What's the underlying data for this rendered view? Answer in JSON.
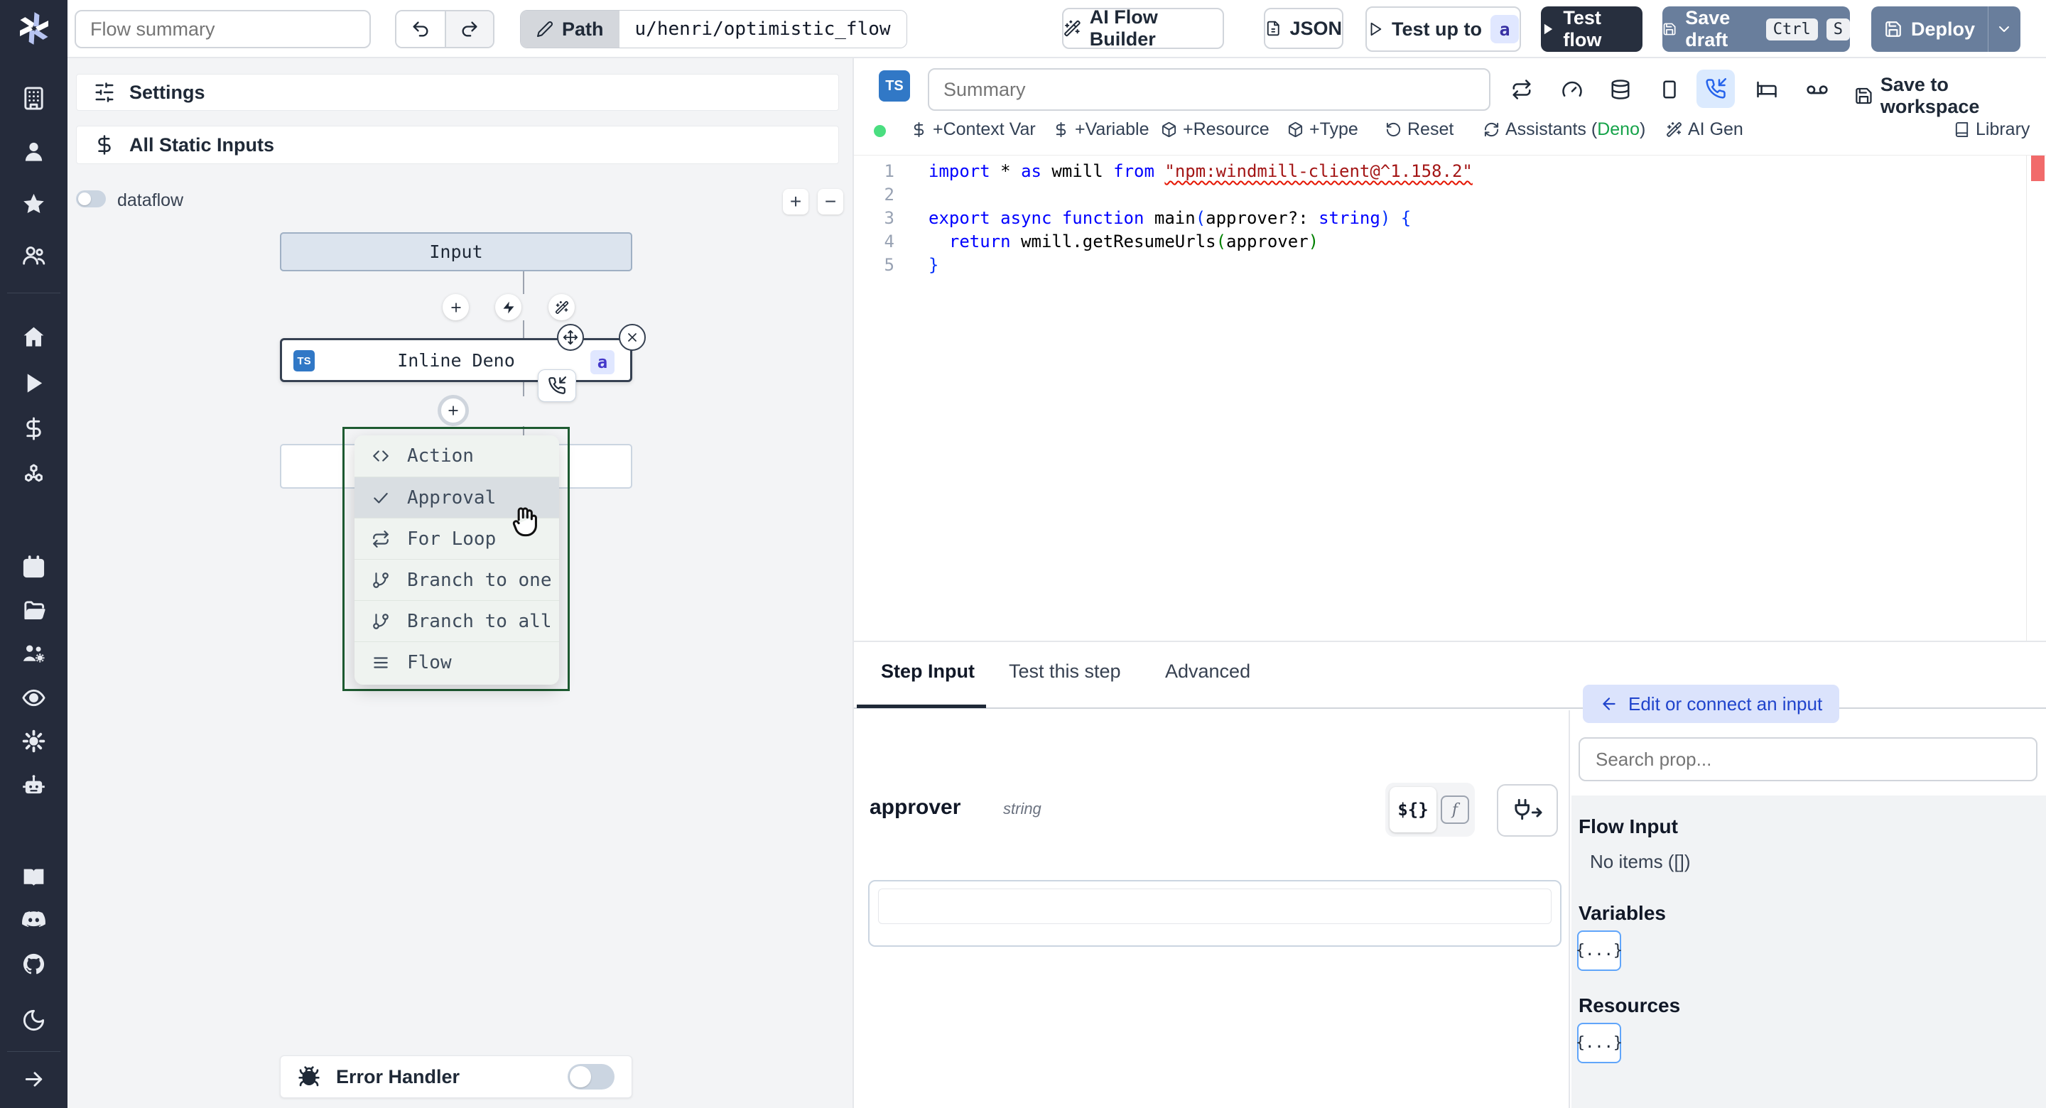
{
  "topbar": {
    "flow_summary_placeholder": "Flow summary",
    "path_label": "Path",
    "path_value": "u/henri/optimistic_flow",
    "ai_flow_builder": "AI Flow Builder",
    "json_button": "JSON",
    "test_up_to": "Test up to",
    "test_up_to_badge": "a",
    "test_flow": "Test flow",
    "save_draft": "Save draft",
    "kbd_ctrl": "Ctrl",
    "kbd_s": "S",
    "deploy": "Deploy"
  },
  "sidebar": {
    "icons": [
      "building",
      "user",
      "star",
      "users",
      "home",
      "play",
      "dollar",
      "boxes",
      "calendar",
      "folder-open",
      "users-gear",
      "eye",
      "settings",
      "bot",
      "book-open",
      "discord",
      "github",
      "moon",
      "arrow-right"
    ]
  },
  "flow": {
    "settings_label": "Settings",
    "static_inputs_label": "All Static Inputs",
    "dataflow_label": "dataflow",
    "zoom_in": "+",
    "zoom_out": "−",
    "input_node": "Input",
    "step_node": "Inline Deno",
    "step_lang_badge": "TS",
    "step_suffix_badge": "a",
    "menu": [
      {
        "icon": "code",
        "label": "Action"
      },
      {
        "icon": "check",
        "label": "Approval"
      },
      {
        "icon": "repeat",
        "label": "For Loop"
      },
      {
        "icon": "git-branch",
        "label": "Branch to one"
      },
      {
        "icon": "git-branch",
        "label": "Branch to all"
      },
      {
        "icon": "menu",
        "label": "Flow"
      }
    ],
    "menu_active_index": 1,
    "error_handler_label": "Error Handler"
  },
  "editor": {
    "lang_badge": "TS",
    "summary_placeholder": "Summary",
    "actions": [
      "+Context Var",
      "+Variable",
      "+Resource",
      "+Type",
      "Reset"
    ],
    "assistants_prefix": "Assistants (",
    "assistants_lang": "Deno",
    "assistants_suffix": ")",
    "ai_gen": "AI Gen",
    "library": "Library",
    "save_to_workspace": "Save to workspace",
    "code": [
      [
        {
          "t": "import",
          "c": "kw"
        },
        {
          "t": " * ",
          "c": "pl"
        },
        {
          "t": "as",
          "c": "kw"
        },
        {
          "t": " wmill ",
          "c": "pl"
        },
        {
          "t": "from",
          "c": "kw"
        },
        {
          "t": " ",
          "c": "pl"
        },
        {
          "t": "\"npm:windmill-client@^1.158.2\"",
          "c": "str sq"
        }
      ],
      [],
      [
        {
          "t": "export",
          "c": "kw"
        },
        {
          "t": " ",
          "c": "pl"
        },
        {
          "t": "async",
          "c": "kw"
        },
        {
          "t": " ",
          "c": "pl"
        },
        {
          "t": "function",
          "c": "kw"
        },
        {
          "t": " main",
          "c": "pl"
        },
        {
          "t": "(",
          "c": "p1"
        },
        {
          "t": "approver?: ",
          "c": "pl"
        },
        {
          "t": "string",
          "c": "kw"
        },
        {
          "t": ")",
          "c": "p1"
        },
        {
          "t": " {",
          "c": "p1"
        }
      ],
      [
        {
          "t": "  ",
          "c": "pl"
        },
        {
          "t": "return",
          "c": "kw"
        },
        {
          "t": " wmill.getResumeUrls",
          "c": "pl"
        },
        {
          "t": "(",
          "c": "p2"
        },
        {
          "t": "approver",
          "c": "pl"
        },
        {
          "t": ")",
          "c": "p2"
        }
      ],
      [
        {
          "t": "}",
          "c": "p1"
        }
      ]
    ]
  },
  "step": {
    "tabs": [
      "Step Input",
      "Test this step",
      "Advanced"
    ],
    "active_tab": "Step Input",
    "field_name": "approver",
    "field_type": "string",
    "expr_button": "${}",
    "fn_button": "f"
  },
  "props": {
    "edit_button": "Edit or connect an input",
    "search_placeholder": "Search prop...",
    "flow_input_title": "Flow Input",
    "flow_input_empty": "No items ([])",
    "variables_title": "Variables",
    "variables_chip": "{...}",
    "resources_title": "Resources",
    "resources_chip": "{...}"
  },
  "colors": {
    "accent_slate": "#697e9c",
    "dark_button": "#272f3e",
    "badge_bg": "#e0e7ff",
    "ts_blue": "#3178c6",
    "menu_green_border": "#1e5b32",
    "active_icon_bg": "#dbeafe",
    "deno_green": "#16a34a",
    "ok_dot": "#4ade80",
    "error_marker": "#f16a6a"
  }
}
